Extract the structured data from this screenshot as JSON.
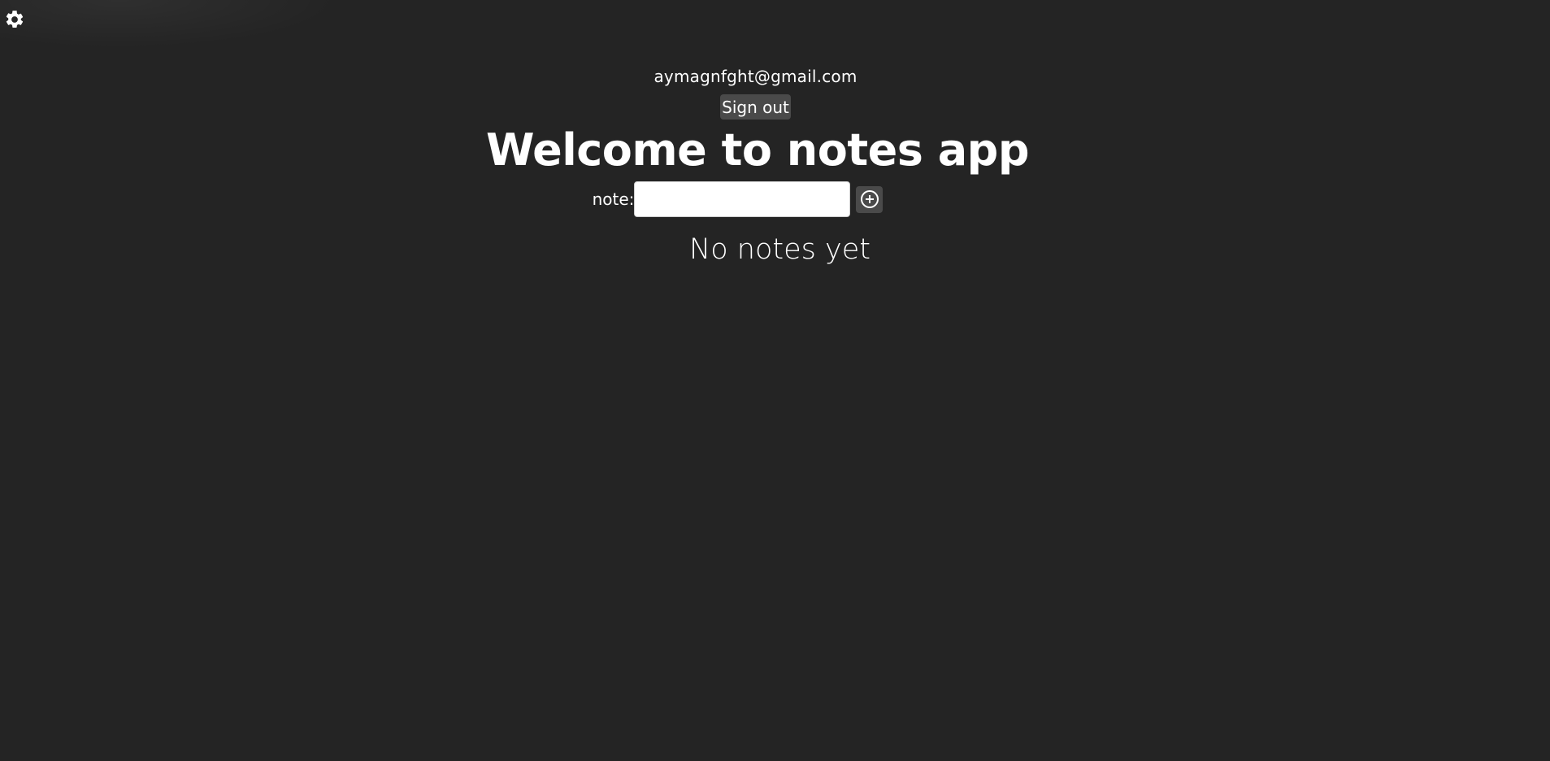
{
  "header": {
    "settings_icon": "gear-icon"
  },
  "account": {
    "email": "aymagnfght@gmail.com",
    "sign_out_label": "Sign out"
  },
  "main": {
    "title": "Welcome to notes app",
    "note_label": "note:",
    "note_input_value": "",
    "add_icon": "plus-circle-icon",
    "empty_message": "No notes yet"
  },
  "colors": {
    "background": "#242424",
    "text": "#ffffff",
    "button_bg": "#4a4a4a"
  }
}
